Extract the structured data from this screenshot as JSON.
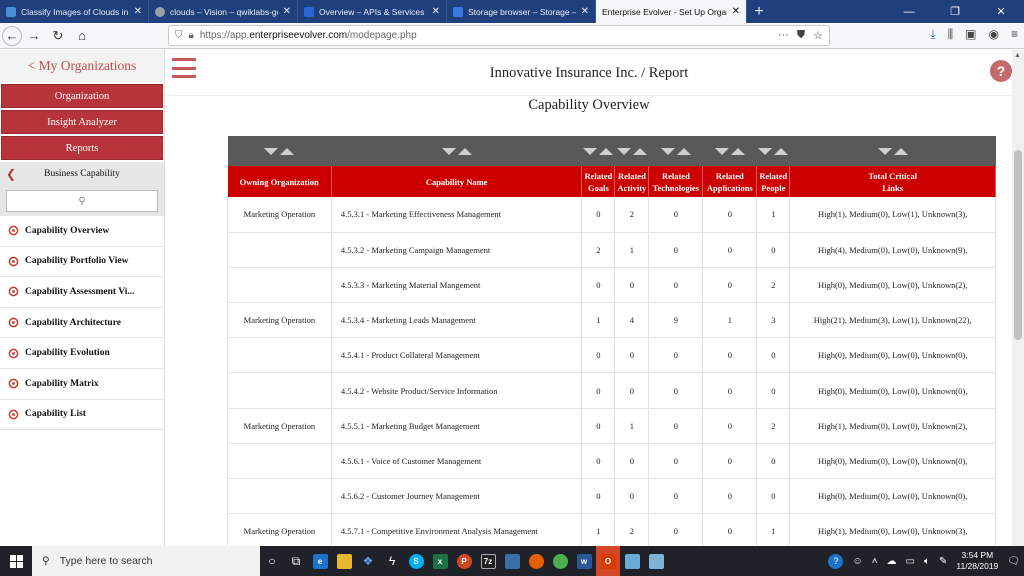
{
  "browser": {
    "tabs": [
      {
        "title": "Classify Images of Clouds in th",
        "color": "#4a90d9"
      },
      {
        "title": "clouds – Vision – qwiklabs-gcp",
        "color": "#5f6368"
      },
      {
        "title": "Overview – APIs & Services – q",
        "color": "#2a66d6"
      },
      {
        "title": "Storage browser – Storage – q",
        "color": "#3b78e7"
      },
      {
        "title": "Enterprise Evolver - Set Up Organiz",
        "color": "#ffffff"
      }
    ],
    "url_prefix": "https://app.",
    "url_domain": "enterpriseevolver.com",
    "url_path": "/modepage.php",
    "url_dots": "···"
  },
  "sidebar": {
    "my_orgs": "< My Organizations",
    "buttons": [
      "Organization",
      "Insight Analyzer",
      "Reports"
    ],
    "business_capability": "Business Capability",
    "items": [
      "Capability Overview",
      "Capability Portfolio View",
      "Capability Assessment Vi...",
      "Capability Architecture",
      "Capability Evolution",
      "Capability Matrix",
      "Capability List"
    ]
  },
  "header": {
    "org_title": "Innovative Insurance Inc. / Report",
    "page_title": "Capability Overview",
    "help": "?"
  },
  "table": {
    "columns": [
      {
        "l1": "Owning Organization",
        "l2": ""
      },
      {
        "l1": "Capability Name",
        "l2": ""
      },
      {
        "l1": "Related",
        "l2": "Goals"
      },
      {
        "l1": "Related",
        "l2": "Activity"
      },
      {
        "l1": "Related",
        "l2": "Technologies"
      },
      {
        "l1": "Related",
        "l2": "Applications"
      },
      {
        "l1": "Related",
        "l2": "People"
      },
      {
        "l1": "Total Critical",
        "l2": "Links"
      }
    ],
    "rows": [
      [
        "Marketing Operation",
        "4.5.3.1 - Marketing Effectiveness Management",
        "0",
        "2",
        "0",
        "0",
        "1",
        "High(1), Medium(0), Low(1), Unknown(3),"
      ],
      [
        "",
        "4.5.3.2 - Marketing Campaign Management",
        "2",
        "1",
        "0",
        "0",
        "0",
        "High(4), Medium(0), Low(0), Unknown(9),"
      ],
      [
        "",
        "4.5.3.3 - Marketing Material Mangement",
        "0",
        "0",
        "0",
        "0",
        "2",
        "High(0), Medium(0), Low(0), Unknown(2),"
      ],
      [
        "Marketing Operation",
        "4.5.3.4 - Marketing Leads Management",
        "1",
        "4",
        "9",
        "1",
        "3",
        "High(21), Medium(3), Low(1), Unknown(22),"
      ],
      [
        "",
        "4.5.4.1 - Product Collateral Management",
        "0",
        "0",
        "0",
        "0",
        "0",
        "High(0), Medium(0), Low(0), Unknown(0),"
      ],
      [
        "",
        "4.5.4.2 - Website Product/Service Information",
        "0",
        "0",
        "0",
        "0",
        "0",
        "High(0), Medium(0), Low(0), Unknown(0),"
      ],
      [
        "Marketing Operation",
        "4.5.5.1 - Marketing Budget Management",
        "0",
        "1",
        "0",
        "0",
        "2",
        "High(1), Medium(0), Low(0), Unknown(2),"
      ],
      [
        "",
        "4.5.6.1 - Voice of Customer Management",
        "0",
        "0",
        "0",
        "0",
        "0",
        "High(0), Medium(0), Low(0), Unknown(0),"
      ],
      [
        "",
        "4.5.6.2 - Customer Journey Management",
        "0",
        "0",
        "0",
        "0",
        "0",
        "High(0), Medium(0), Low(0), Unknown(0),"
      ],
      [
        "Marketing Operation",
        "4.5.7.1 - Competitive Environment Analysis Management",
        "1",
        "2",
        "0",
        "0",
        "1",
        "High(1), Medium(0), Low(0), Unknown(3),"
      ]
    ]
  },
  "taskbar": {
    "search_placeholder": "Type here to search",
    "time": "3:54 PM",
    "date": "11/28/2019"
  },
  "colors": {
    "accent_red": "#cc0000",
    "sidebar_red": "#b8343b",
    "tabbar": "#1f3f7d"
  }
}
